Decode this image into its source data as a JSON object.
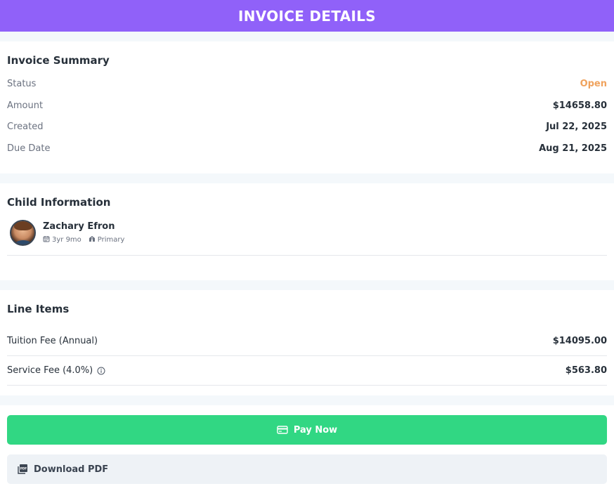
{
  "header": {
    "title": "INVOICE DETAILS"
  },
  "summary": {
    "title": "Invoice Summary",
    "rows": [
      {
        "label": "Status",
        "value": "Open"
      },
      {
        "label": "Amount",
        "value": "$14658.80"
      },
      {
        "label": "Created",
        "value": "Jul 22, 2025"
      },
      {
        "label": "Due Date",
        "value": "Aug 21, 2025"
      }
    ]
  },
  "child": {
    "title": "Child Information",
    "name": "Zachary Efron",
    "age": "3yr 9mo",
    "level": "Primary",
    "icons": {
      "age": "calendar-icon",
      "level": "school-icon"
    }
  },
  "line_items": {
    "title": "Line Items",
    "rows": [
      {
        "label": "Tuition Fee (Annual)",
        "value": "$14095.00"
      },
      {
        "label": "Service Fee (4.0%)",
        "value": "$563.80"
      }
    ]
  },
  "actions": {
    "pay_label": "Pay Now",
    "download_label": "Download PDF"
  },
  "colors": {
    "header": "#9061f9",
    "status_open": "#f0a35e",
    "pay_button": "#31d783",
    "download_button": "#eef2f6"
  }
}
